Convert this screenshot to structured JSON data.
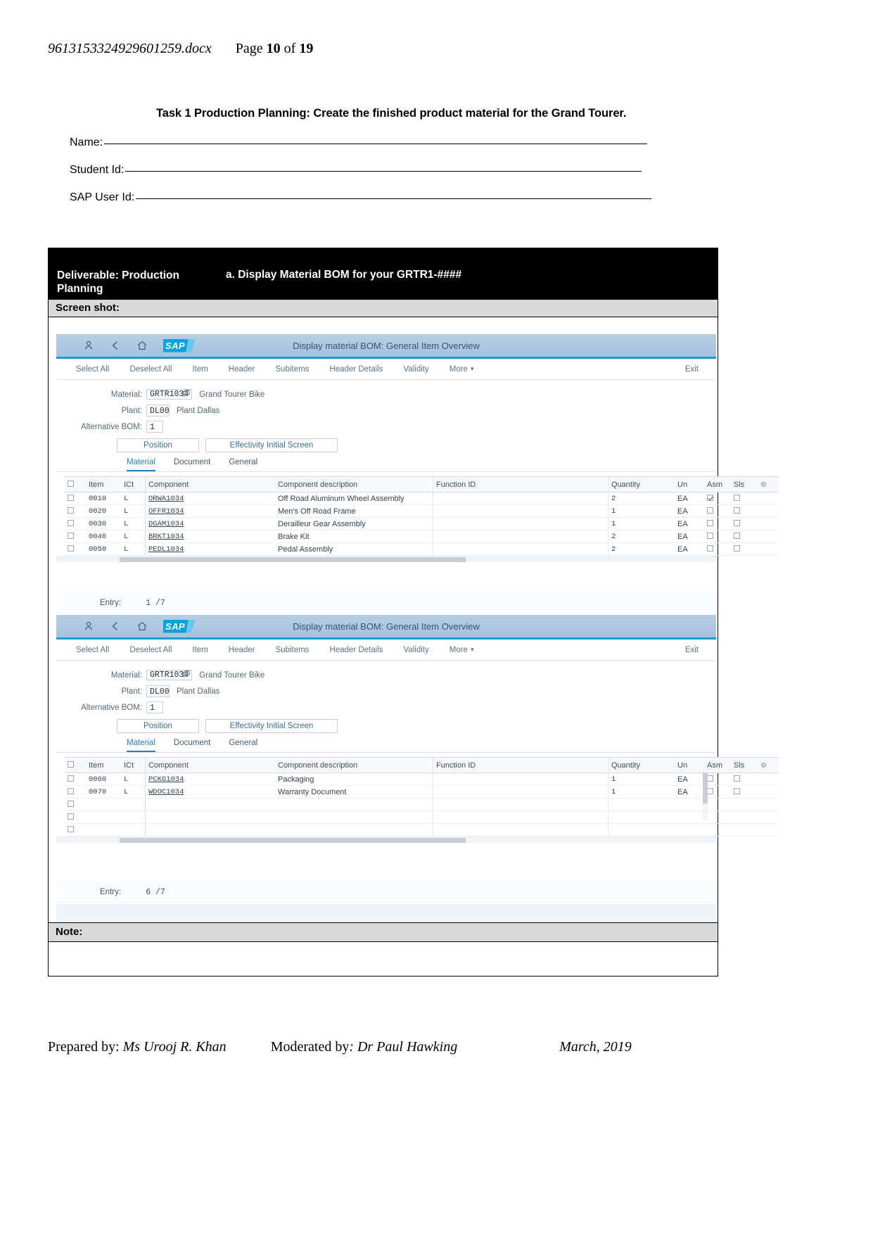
{
  "doc_header": {
    "filename": "9613153324929601259.docx",
    "page_word": "Page",
    "page_number": "10",
    "of_word": "of",
    "total_pages": "19"
  },
  "task": {
    "title": "Task 1 Production Planning: Create the finished product material for the Grand Tourer.",
    "fields": [
      {
        "label": "Name:"
      },
      {
        "label": "Student Id:"
      },
      {
        "label": "SAP User Id:"
      }
    ]
  },
  "deliverable": {
    "left_label": "Deliverable: Production Planning",
    "right_label": "a. Display Material BOM for your GRTR1-####",
    "screenshot_label": "Screen shot:",
    "note_label": "Note:"
  },
  "sap": {
    "shell": {
      "title": "Display material BOM: General Item Overview",
      "user_icon": "user-icon",
      "back_icon": "back-chevron-icon",
      "home_icon": "home-icon",
      "logo_text": "SAP"
    },
    "toolbar": {
      "items": [
        "Select All",
        "Deselect All",
        "Item",
        "Header",
        "Subitems",
        "Header Details",
        "Validity",
        "More"
      ],
      "exit": "Exit"
    },
    "form": {
      "material_label": "Material:",
      "material_value": "GRTR1034",
      "material_desc": "Grand Tourer Bike",
      "plant_label": "Plant:",
      "plant_value": "DL00",
      "plant_desc": "Plant Dallas",
      "altbom_label": "Alternative BOM:",
      "altbom_value": "1",
      "position_button": "Position",
      "effectivity_button": "Effectivity Initial Screen",
      "tabs": [
        "Material",
        "Document",
        "General"
      ],
      "active_tab": "Material"
    },
    "table": {
      "columns": [
        "Item",
        "ICt",
        "Component",
        "Component description",
        "Function ID",
        "Quantity",
        "Un",
        "Asm",
        "Sls"
      ],
      "settings_icon": "gear-icon"
    },
    "panel1": {
      "rows": [
        {
          "item": "0010",
          "ict": "L",
          "component": "ORWA1034",
          "description": "Off Road Aluminum Wheel Assembly",
          "function_id": "",
          "quantity": "2",
          "un": "EA",
          "asm": true,
          "sls": false
        },
        {
          "item": "0020",
          "ict": "L",
          "component": "OFFR1034",
          "description": "Men's Off Road Frame",
          "function_id": "",
          "quantity": "1",
          "un": "EA",
          "asm": false,
          "sls": false
        },
        {
          "item": "0030",
          "ict": "L",
          "component": "DGAM1034",
          "description": "Derailleur Gear Assembly",
          "function_id": "",
          "quantity": "1",
          "un": "EA",
          "asm": false,
          "sls": false
        },
        {
          "item": "0040",
          "ict": "L",
          "component": "BRKT1034",
          "description": "Brake Kit",
          "function_id": "",
          "quantity": "2",
          "un": "EA",
          "asm": false,
          "sls": false
        },
        {
          "item": "0050",
          "ict": "L",
          "component": "PEDL1034",
          "description": "Pedal Assembly",
          "function_id": "",
          "quantity": "2",
          "un": "EA",
          "asm": false,
          "sls": false
        }
      ],
      "entry_label": "Entry:",
      "entry_value": "1  /7"
    },
    "panel2": {
      "rows": [
        {
          "item": "0060",
          "ict": "L",
          "component": "PCKG1034",
          "description": "Packaging",
          "function_id": "",
          "quantity": "1",
          "un": "EA",
          "asm": false,
          "sls": false
        },
        {
          "item": "0070",
          "ict": "L",
          "component": "WDOC1034",
          "description": "Warranty Document",
          "function_id": "",
          "quantity": "1",
          "un": "EA",
          "asm": false,
          "sls": false
        }
      ],
      "empty_rows": 3,
      "entry_label": "Entry:",
      "entry_value": "6  /7"
    }
  },
  "footer": {
    "prepared_label": "Prepared by:",
    "prepared_name": "Ms Urooj R. Khan",
    "moderated_label": "Moderated by",
    "moderated_name": ": Dr Paul Hawking",
    "date": "March, 2019"
  }
}
